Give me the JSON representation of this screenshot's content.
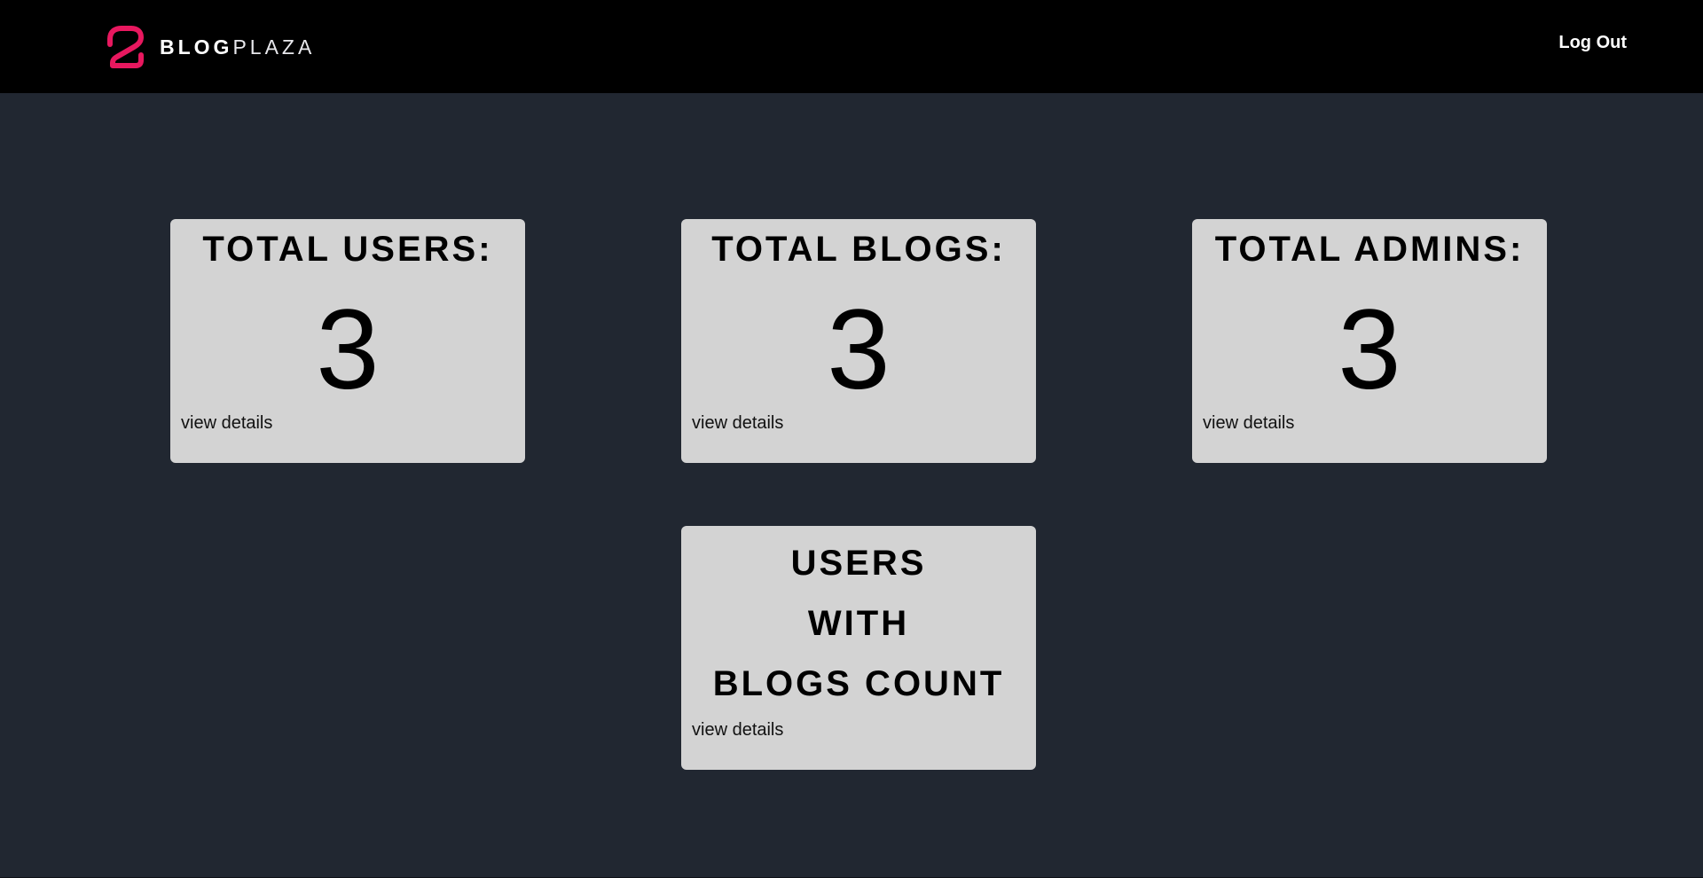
{
  "header": {
    "brand": {
      "part1": "BLOG",
      "part2": "PLAZA"
    },
    "logout_label": "Log Out"
  },
  "cards": [
    {
      "title": "TOTAL USERS:",
      "value": "3",
      "link": "view details"
    },
    {
      "title": "TOTAL BLOGS:",
      "value": "3",
      "link": "view details"
    },
    {
      "title": "TOTAL ADMINS:",
      "value": "3",
      "link": "view details"
    }
  ],
  "users_blogs_card": {
    "title_lines": [
      "USERS",
      "WITH",
      "BLOGS COUNT"
    ],
    "link": "view details"
  },
  "colors": {
    "navbar": "#000000",
    "background": "#212731",
    "card": "#d3d3d3",
    "logo_accent": "#e8185f"
  }
}
